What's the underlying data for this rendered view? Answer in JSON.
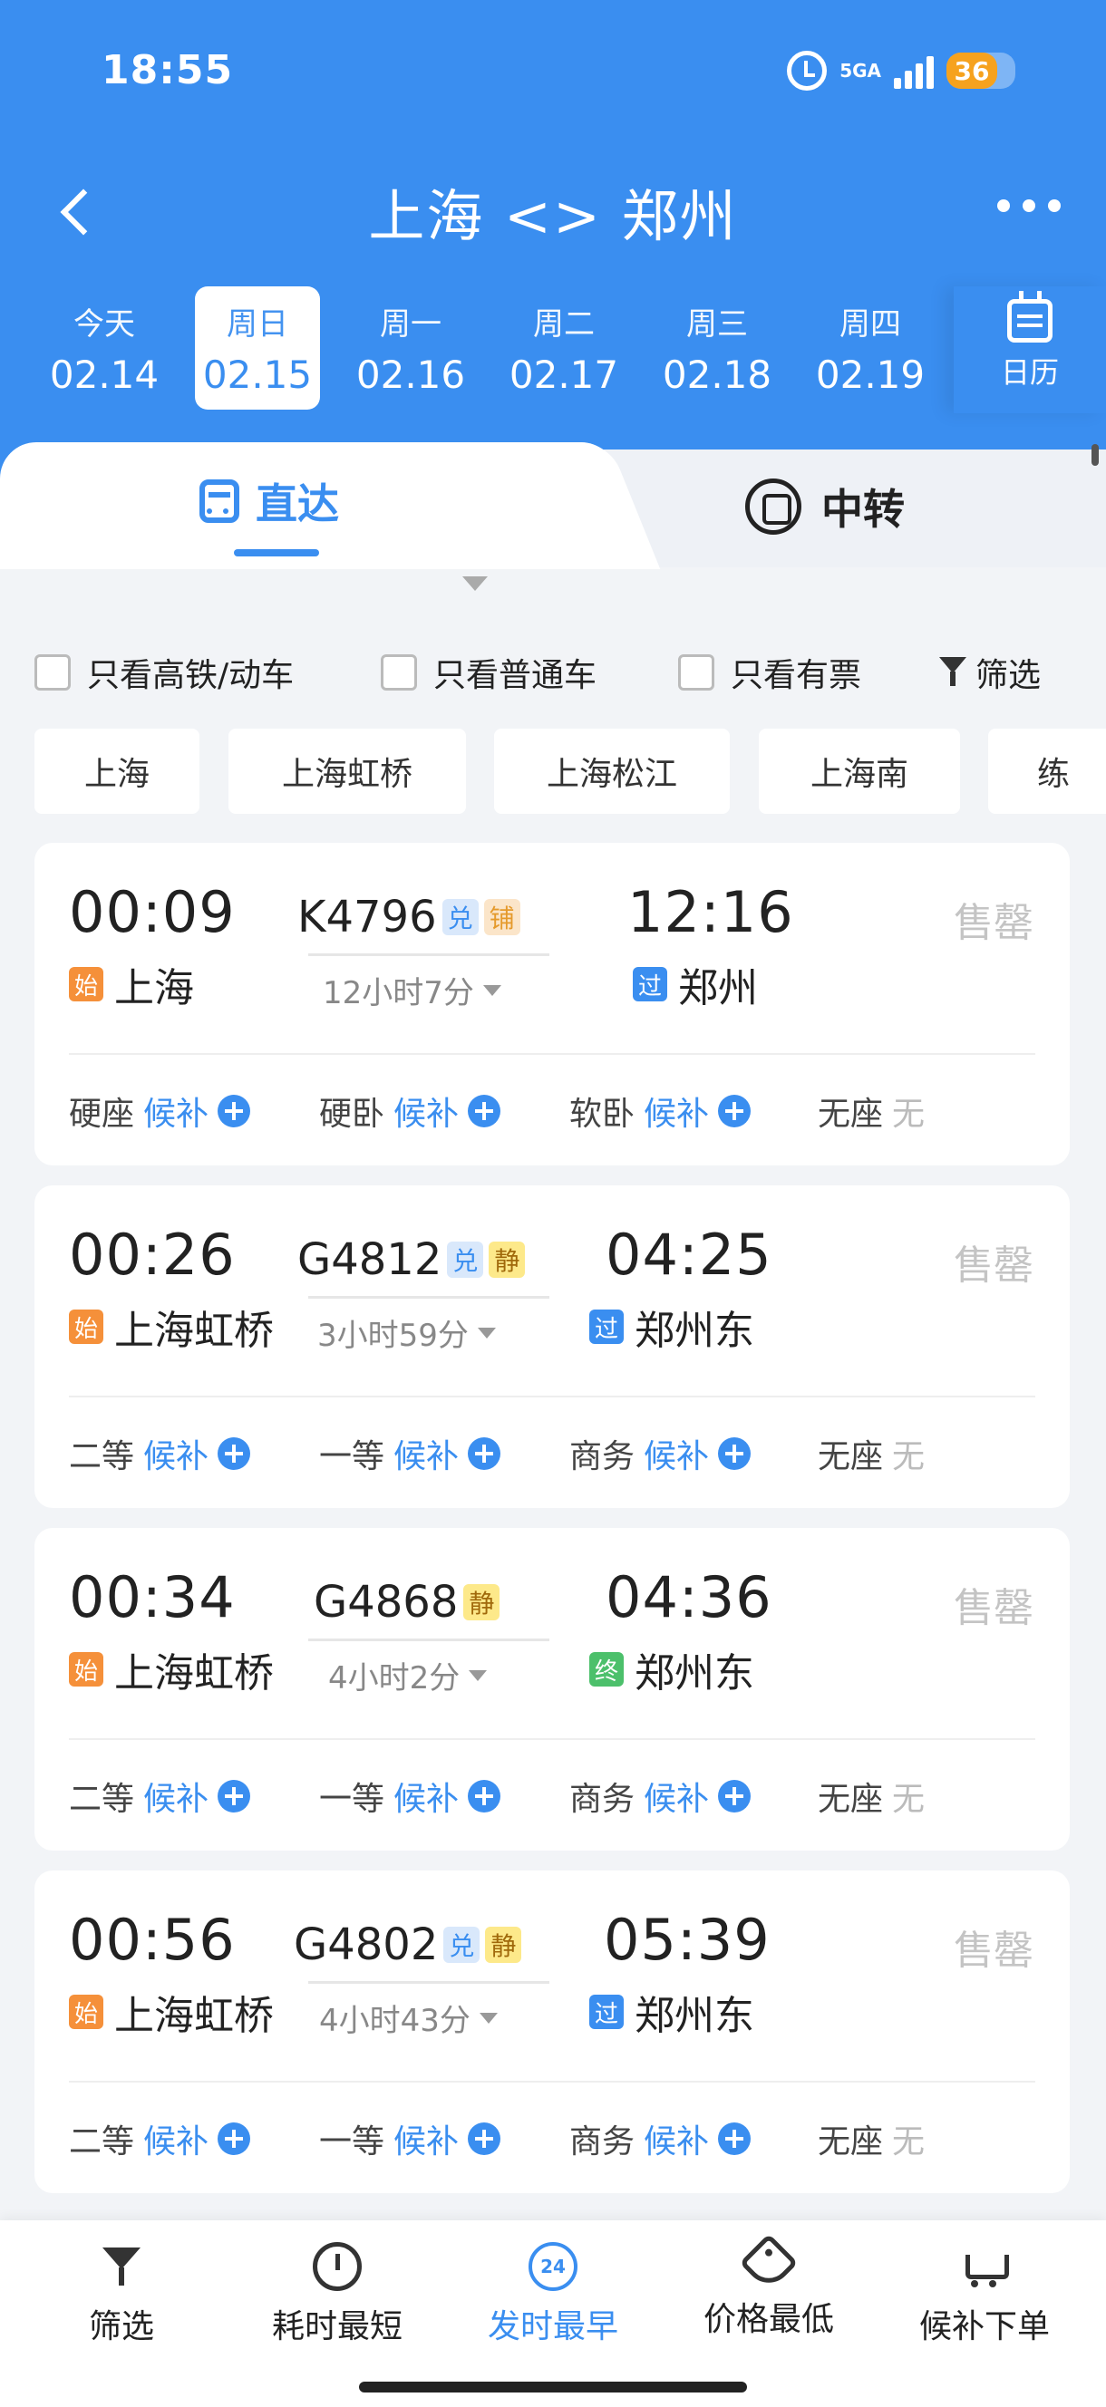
{
  "status": {
    "time": "18:55",
    "network": "5GA",
    "battery": "36"
  },
  "nav": {
    "title": "上海 <> 郑州"
  },
  "dates": [
    {
      "dow": "今天",
      "date": "02.14"
    },
    {
      "dow": "周日",
      "date": "02.15"
    },
    {
      "dow": "周一",
      "date": "02.16"
    },
    {
      "dow": "周二",
      "date": "02.17"
    },
    {
      "dow": "周三",
      "date": "02.18"
    },
    {
      "dow": "周四",
      "date": "02.19"
    }
  ],
  "selected_date_index": 1,
  "calendar_label": "日历",
  "tabs": {
    "direct": "直达",
    "transfer": "中转"
  },
  "filters": {
    "high_speed": "只看高铁/动车",
    "regular": "只看普通车",
    "available": "只看有票",
    "filter": "筛选"
  },
  "stations": [
    "上海",
    "上海虹桥",
    "上海松江",
    "上海南",
    "练"
  ],
  "colors": {
    "primary": "#3a8ef0",
    "start_tag": "#f5903a",
    "end_tag": "#4cc06b"
  },
  "trains": [
    {
      "dep": "00:09",
      "no": "K4796",
      "badges": [
        "兑",
        "铺"
      ],
      "duration": "12小时7分",
      "arr": "12:16",
      "from": "上海",
      "from_tag": "始",
      "to": "郑州",
      "to_tag": "过",
      "status": "售罄",
      "seats": [
        {
          "name": "硬座",
          "state": "候补"
        },
        {
          "name": "硬卧",
          "state": "候补"
        },
        {
          "name": "软卧",
          "state": "候补"
        },
        {
          "name": "无座",
          "state": "无"
        }
      ]
    },
    {
      "dep": "00:26",
      "no": "G4812",
      "badges": [
        "兑",
        "静"
      ],
      "duration": "3小时59分",
      "arr": "04:25",
      "from": "上海虹桥",
      "from_tag": "始",
      "to": "郑州东",
      "to_tag": "过",
      "status": "售罄",
      "seats": [
        {
          "name": "二等",
          "state": "候补"
        },
        {
          "name": "一等",
          "state": "候补"
        },
        {
          "name": "商务",
          "state": "候补"
        },
        {
          "name": "无座",
          "state": "无"
        }
      ]
    },
    {
      "dep": "00:34",
      "no": "G4868",
      "badges": [
        "静"
      ],
      "duration": "4小时2分",
      "arr": "04:36",
      "from": "上海虹桥",
      "from_tag": "始",
      "to": "郑州东",
      "to_tag": "终",
      "status": "售罄",
      "seats": [
        {
          "name": "二等",
          "state": "候补"
        },
        {
          "name": "一等",
          "state": "候补"
        },
        {
          "name": "商务",
          "state": "候补"
        },
        {
          "name": "无座",
          "state": "无"
        }
      ]
    },
    {
      "dep": "00:56",
      "no": "G4802",
      "badges": [
        "兑",
        "静"
      ],
      "duration": "4小时43分",
      "arr": "05:39",
      "from": "上海虹桥",
      "from_tag": "始",
      "to": "郑州东",
      "to_tag": "过",
      "status": "售罄",
      "seats": [
        {
          "name": "二等",
          "state": "候补"
        },
        {
          "name": "一等",
          "state": "候补"
        },
        {
          "name": "商务",
          "state": "候补"
        },
        {
          "name": "无座",
          "state": "无"
        }
      ]
    }
  ],
  "bottom_bar": [
    {
      "label": "筛选",
      "icon": "funnel-icon"
    },
    {
      "label": "耗时最短",
      "icon": "timer-icon"
    },
    {
      "label": "发时最早",
      "icon": "clock-24-icon",
      "icon_text": "24"
    },
    {
      "label": "价格最低",
      "icon": "price-tag-icon"
    },
    {
      "label": "候补下单",
      "icon": "cart-plus-icon"
    }
  ],
  "active_sort_index": 2
}
